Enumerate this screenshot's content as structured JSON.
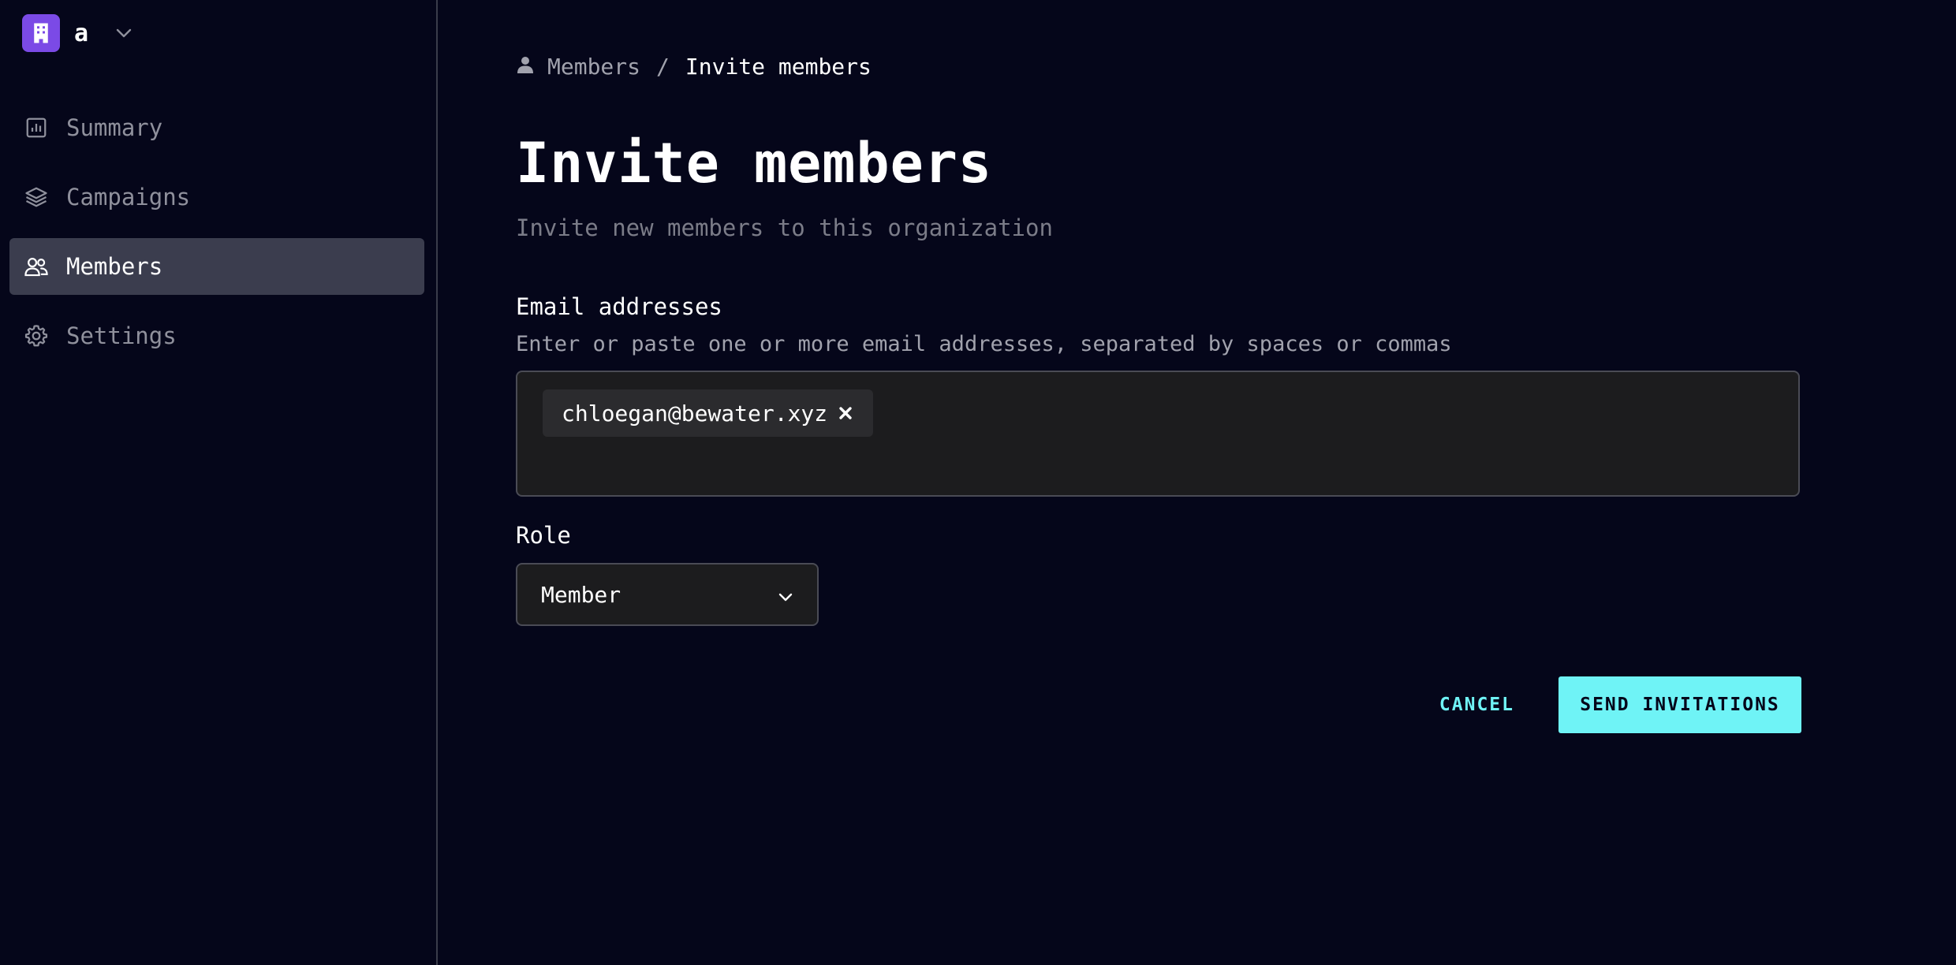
{
  "org": {
    "name": "a",
    "logo_color": "#7b4ae6"
  },
  "sidebar": {
    "items": [
      {
        "label": "Summary",
        "icon": "bar-chart-icon",
        "active": false
      },
      {
        "label": "Campaigns",
        "icon": "layers-icon",
        "active": false
      },
      {
        "label": "Members",
        "icon": "users-icon",
        "active": true
      },
      {
        "label": "Settings",
        "icon": "gear-icon",
        "active": false
      }
    ]
  },
  "breadcrumb": {
    "parent": "Members",
    "separator": "/",
    "current": "Invite members",
    "icon": "person-icon"
  },
  "page": {
    "title": "Invite members",
    "subtitle": "Invite new members to this organization"
  },
  "email": {
    "label": "Email addresses",
    "hint": "Enter or paste one or more email addresses, separated by spaces or commas",
    "chips": [
      "chloegan@bewater.xyz"
    ]
  },
  "role": {
    "label": "Role",
    "selected": "Member"
  },
  "actions": {
    "cancel_label": "CANCEL",
    "send_label": "SEND INVITATIONS"
  },
  "colors": {
    "background": "#05061a",
    "accent": "#6ff3f6",
    "active_nav": "#3b3d4e"
  }
}
